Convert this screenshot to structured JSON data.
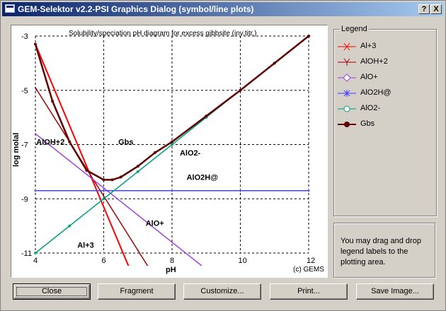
{
  "window": {
    "title": "GEM-Selektor v2.2-PSI Graphics Dialog (symbol/line plots)",
    "help_button": "?",
    "close_button": "X"
  },
  "chart_data": {
    "type": "line",
    "title": "Solubility/speciation pH diagram for excess gibbsite (inv.titr.)",
    "xlabel": "pH",
    "ylabel": "log molal",
    "xlim": [
      4,
      12
    ],
    "ylim": [
      -11,
      -3
    ],
    "xticks": [
      "4",
      "6",
      "8",
      "10",
      "12"
    ],
    "yticks": [
      "-3",
      "-5",
      "-7",
      "-9",
      "-11"
    ],
    "grid": true,
    "annotations": {
      "credit": "(c) GEMS",
      "labels": [
        {
          "text": "AlOH+2",
          "x": 4.4,
          "y": -7.0
        },
        {
          "text": "Gbs",
          "x": 6.8,
          "y": -7.0
        },
        {
          "text": "AlO2-",
          "x": 8.6,
          "y": -7.4
        },
        {
          "text": "AlO2H@",
          "x": 8.8,
          "y": -8.3
        },
        {
          "text": "AlO+",
          "x": 7.6,
          "y": -10.0
        },
        {
          "text": "Al+3",
          "x": 5.6,
          "y": -10.8
        }
      ]
    },
    "series": [
      {
        "name": "Al+3",
        "color": "#ff0000",
        "marker": "x",
        "x": [
          4.0,
          5.0,
          5.5,
          6.0,
          6.5,
          7.0
        ],
        "y": [
          -3.3,
          -6.3,
          -7.8,
          -9.3,
          -10.8,
          -12.3
        ]
      },
      {
        "name": "AlOH+2",
        "color": "#a00000",
        "marker": "y",
        "x": [
          4.0,
          5.0,
          6.0,
          7.0,
          8.0
        ],
        "y": [
          -4.9,
          -6.9,
          -8.9,
          -10.9,
          -12.9
        ]
      },
      {
        "name": "AlO+",
        "color": "#a040e0",
        "marker": "diamond",
        "x": [
          4.0,
          5.0,
          6.0,
          7.0,
          8.0,
          9.0
        ],
        "y": [
          -6.6,
          -7.6,
          -8.6,
          -9.6,
          -10.6,
          -11.6
        ]
      },
      {
        "name": "AlO2H@",
        "color": "#4040ff",
        "marker": "star",
        "x": [
          4.0,
          6.0,
          8.0,
          10.0,
          12.0
        ],
        "y": [
          -8.7,
          -8.7,
          -8.7,
          -8.7,
          -8.7
        ]
      },
      {
        "name": "AlO2-",
        "color": "#00a080",
        "marker": "circle",
        "x": [
          4.0,
          5.0,
          6.0,
          7.0,
          8.0,
          9.0,
          10.0,
          11.0,
          12.0
        ],
        "y": [
          -11.0,
          -10.0,
          -9.0,
          -8.0,
          -7.0,
          -6.0,
          -5.0,
          -4.0,
          -3.0
        ]
      },
      {
        "name": "Gbs",
        "color": "#600000",
        "marker": "filled-circle",
        "x": [
          4.0,
          4.5,
          5.0,
          5.5,
          6.0,
          6.25,
          6.5,
          7.0,
          7.5,
          8.0,
          9.0,
          10.0,
          11.0,
          12.0
        ],
        "y": [
          -3.3,
          -5.4,
          -6.9,
          -7.95,
          -8.3,
          -8.3,
          -8.2,
          -7.8,
          -7.3,
          -6.9,
          -5.95,
          -5.0,
          -4.0,
          -3.0
        ]
      }
    ]
  },
  "legend": {
    "title": "Legend",
    "items": [
      "Al+3",
      "AlOH+2",
      "AlO+",
      "AlO2H@",
      "AlO2-",
      "Gbs"
    ]
  },
  "note": "You may drag and drop legend labels to the plotting area.",
  "buttons": {
    "close": "Close",
    "fragment": "Fragment",
    "customize": "Customize...",
    "print": "Print...",
    "save_image": "Save Image..."
  }
}
